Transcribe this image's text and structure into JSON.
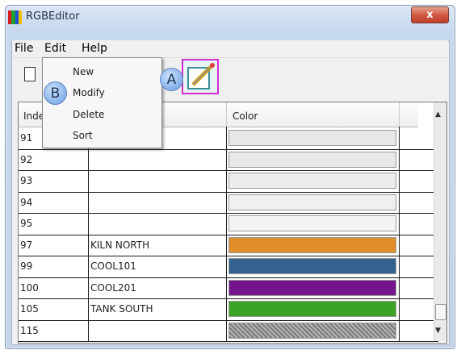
{
  "window": {
    "title": "RGBEditor",
    "close_label": "x"
  },
  "menubar": {
    "items": [
      "File",
      "Edit",
      "Help"
    ]
  },
  "edit_menu": {
    "items": [
      "New",
      "Modify",
      "Delete",
      "Sort"
    ]
  },
  "callouts": {
    "a": "A",
    "b": "B"
  },
  "table": {
    "columns": [
      "Index",
      "",
      "Color"
    ],
    "rows": [
      {
        "index": "91",
        "name": "",
        "color": "#e8e8e8"
      },
      {
        "index": "92",
        "name": "",
        "color": "#e8e8e8"
      },
      {
        "index": "93",
        "name": "",
        "color": "#ececec"
      },
      {
        "index": "94",
        "name": "",
        "color": "#f0f0f0"
      },
      {
        "index": "95",
        "name": "",
        "color": "#f4f4f4"
      },
      {
        "index": "97",
        "name": "KILN NORTH",
        "color": "#e08e2a"
      },
      {
        "index": "99",
        "name": "COOL101",
        "color": "#336190"
      },
      {
        "index": "100",
        "name": "COOL201",
        "color": "#75158b"
      },
      {
        "index": "105",
        "name": "TANK SOUTH",
        "color": "#3aa324"
      },
      {
        "index": "115",
        "name": "",
        "color": "#9a9a9a"
      }
    ]
  },
  "colors": {
    "app_icon": [
      "#d81e1e",
      "#20a030",
      "#1e4fd0",
      "#f0c000"
    ]
  }
}
